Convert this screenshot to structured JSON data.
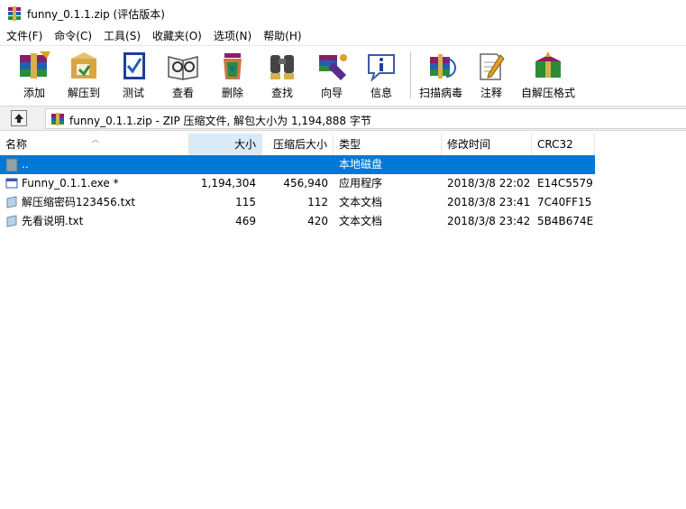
{
  "window": {
    "title": "funny_0.1.1.zip (评估版本)",
    "app_icon": "winrar-icon"
  },
  "menu": [
    "文件(F)",
    "命令(C)",
    "工具(S)",
    "收藏夹(O)",
    "选项(N)",
    "帮助(H)"
  ],
  "toolbar": {
    "buttons": [
      {
        "label": "添加",
        "icon": "add-archive-icon"
      },
      {
        "label": "解压到",
        "icon": "extract-to-icon"
      },
      {
        "label": "测试",
        "icon": "test-icon"
      },
      {
        "label": "查看",
        "icon": "view-icon"
      },
      {
        "label": "删除",
        "icon": "delete-icon"
      },
      {
        "label": "查找",
        "icon": "find-icon"
      },
      {
        "label": "向导",
        "icon": "wizard-icon"
      },
      {
        "label": "信息",
        "icon": "info-icon"
      },
      {
        "label": "扫描病毒",
        "icon": "virus-scan-icon"
      },
      {
        "label": "注释",
        "icon": "comment-icon"
      },
      {
        "label": "自解压格式",
        "icon": "sfx-icon"
      }
    ]
  },
  "address": {
    "text": "funny_0.1.1.zip - ZIP 压缩文件, 解包大小为 1,194,888 字节"
  },
  "columns": {
    "name": "名称",
    "size": "大小",
    "packed": "压缩后大小",
    "type": "类型",
    "modified": "修改时间",
    "crc": "CRC32"
  },
  "rows": [
    {
      "name": "..",
      "size": "",
      "packed": "",
      "type": "本地磁盘",
      "modified": "",
      "crc": "",
      "icon": "parent-folder-icon",
      "selected": true
    },
    {
      "name": "Funny_0.1.1.exe *",
      "size": "1,194,304",
      "packed": "456,940",
      "type": "应用程序",
      "modified": "2018/3/8 22:02",
      "crc": "E14C5579",
      "icon": "exe-file-icon",
      "selected": false
    },
    {
      "name": "解压缩密码123456.txt",
      "size": "115",
      "packed": "112",
      "type": "文本文档",
      "modified": "2018/3/8 23:41",
      "crc": "7C40FF15",
      "icon": "text-file-icon",
      "selected": false
    },
    {
      "name": "先看说明.txt",
      "size": "469",
      "packed": "420",
      "type": "文本文档",
      "modified": "2018/3/8 23:42",
      "crc": "5B4B674E",
      "icon": "text-file-icon",
      "selected": false
    }
  ],
  "colors": {
    "selection": "#0078d7",
    "sorted_header": "#d9ebf9"
  }
}
